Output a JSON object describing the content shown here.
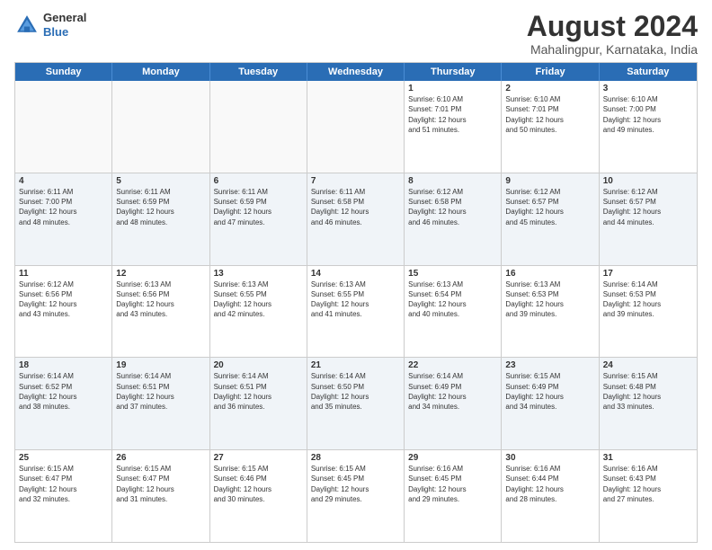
{
  "header": {
    "logo_general": "General",
    "logo_blue": "Blue",
    "month_year": "August 2024",
    "location": "Mahalingpur, Karnataka, India"
  },
  "weekdays": [
    "Sunday",
    "Monday",
    "Tuesday",
    "Wednesday",
    "Thursday",
    "Friday",
    "Saturday"
  ],
  "rows": [
    {
      "alt": false,
      "cells": [
        {
          "day": "",
          "info": ""
        },
        {
          "day": "",
          "info": ""
        },
        {
          "day": "",
          "info": ""
        },
        {
          "day": "",
          "info": ""
        },
        {
          "day": "1",
          "info": "Sunrise: 6:10 AM\nSunset: 7:01 PM\nDaylight: 12 hours\nand 51 minutes."
        },
        {
          "day": "2",
          "info": "Sunrise: 6:10 AM\nSunset: 7:01 PM\nDaylight: 12 hours\nand 50 minutes."
        },
        {
          "day": "3",
          "info": "Sunrise: 6:10 AM\nSunset: 7:00 PM\nDaylight: 12 hours\nand 49 minutes."
        }
      ]
    },
    {
      "alt": true,
      "cells": [
        {
          "day": "4",
          "info": "Sunrise: 6:11 AM\nSunset: 7:00 PM\nDaylight: 12 hours\nand 48 minutes."
        },
        {
          "day": "5",
          "info": "Sunrise: 6:11 AM\nSunset: 6:59 PM\nDaylight: 12 hours\nand 48 minutes."
        },
        {
          "day": "6",
          "info": "Sunrise: 6:11 AM\nSunset: 6:59 PM\nDaylight: 12 hours\nand 47 minutes."
        },
        {
          "day": "7",
          "info": "Sunrise: 6:11 AM\nSunset: 6:58 PM\nDaylight: 12 hours\nand 46 minutes."
        },
        {
          "day": "8",
          "info": "Sunrise: 6:12 AM\nSunset: 6:58 PM\nDaylight: 12 hours\nand 46 minutes."
        },
        {
          "day": "9",
          "info": "Sunrise: 6:12 AM\nSunset: 6:57 PM\nDaylight: 12 hours\nand 45 minutes."
        },
        {
          "day": "10",
          "info": "Sunrise: 6:12 AM\nSunset: 6:57 PM\nDaylight: 12 hours\nand 44 minutes."
        }
      ]
    },
    {
      "alt": false,
      "cells": [
        {
          "day": "11",
          "info": "Sunrise: 6:12 AM\nSunset: 6:56 PM\nDaylight: 12 hours\nand 43 minutes."
        },
        {
          "day": "12",
          "info": "Sunrise: 6:13 AM\nSunset: 6:56 PM\nDaylight: 12 hours\nand 43 minutes."
        },
        {
          "day": "13",
          "info": "Sunrise: 6:13 AM\nSunset: 6:55 PM\nDaylight: 12 hours\nand 42 minutes."
        },
        {
          "day": "14",
          "info": "Sunrise: 6:13 AM\nSunset: 6:55 PM\nDaylight: 12 hours\nand 41 minutes."
        },
        {
          "day": "15",
          "info": "Sunrise: 6:13 AM\nSunset: 6:54 PM\nDaylight: 12 hours\nand 40 minutes."
        },
        {
          "day": "16",
          "info": "Sunrise: 6:13 AM\nSunset: 6:53 PM\nDaylight: 12 hours\nand 39 minutes."
        },
        {
          "day": "17",
          "info": "Sunrise: 6:14 AM\nSunset: 6:53 PM\nDaylight: 12 hours\nand 39 minutes."
        }
      ]
    },
    {
      "alt": true,
      "cells": [
        {
          "day": "18",
          "info": "Sunrise: 6:14 AM\nSunset: 6:52 PM\nDaylight: 12 hours\nand 38 minutes."
        },
        {
          "day": "19",
          "info": "Sunrise: 6:14 AM\nSunset: 6:51 PM\nDaylight: 12 hours\nand 37 minutes."
        },
        {
          "day": "20",
          "info": "Sunrise: 6:14 AM\nSunset: 6:51 PM\nDaylight: 12 hours\nand 36 minutes."
        },
        {
          "day": "21",
          "info": "Sunrise: 6:14 AM\nSunset: 6:50 PM\nDaylight: 12 hours\nand 35 minutes."
        },
        {
          "day": "22",
          "info": "Sunrise: 6:14 AM\nSunset: 6:49 PM\nDaylight: 12 hours\nand 34 minutes."
        },
        {
          "day": "23",
          "info": "Sunrise: 6:15 AM\nSunset: 6:49 PM\nDaylight: 12 hours\nand 34 minutes."
        },
        {
          "day": "24",
          "info": "Sunrise: 6:15 AM\nSunset: 6:48 PM\nDaylight: 12 hours\nand 33 minutes."
        }
      ]
    },
    {
      "alt": false,
      "cells": [
        {
          "day": "25",
          "info": "Sunrise: 6:15 AM\nSunset: 6:47 PM\nDaylight: 12 hours\nand 32 minutes."
        },
        {
          "day": "26",
          "info": "Sunrise: 6:15 AM\nSunset: 6:47 PM\nDaylight: 12 hours\nand 31 minutes."
        },
        {
          "day": "27",
          "info": "Sunrise: 6:15 AM\nSunset: 6:46 PM\nDaylight: 12 hours\nand 30 minutes."
        },
        {
          "day": "28",
          "info": "Sunrise: 6:15 AM\nSunset: 6:45 PM\nDaylight: 12 hours\nand 29 minutes."
        },
        {
          "day": "29",
          "info": "Sunrise: 6:16 AM\nSunset: 6:45 PM\nDaylight: 12 hours\nand 29 minutes."
        },
        {
          "day": "30",
          "info": "Sunrise: 6:16 AM\nSunset: 6:44 PM\nDaylight: 12 hours\nand 28 minutes."
        },
        {
          "day": "31",
          "info": "Sunrise: 6:16 AM\nSunset: 6:43 PM\nDaylight: 12 hours\nand 27 minutes."
        }
      ]
    }
  ]
}
